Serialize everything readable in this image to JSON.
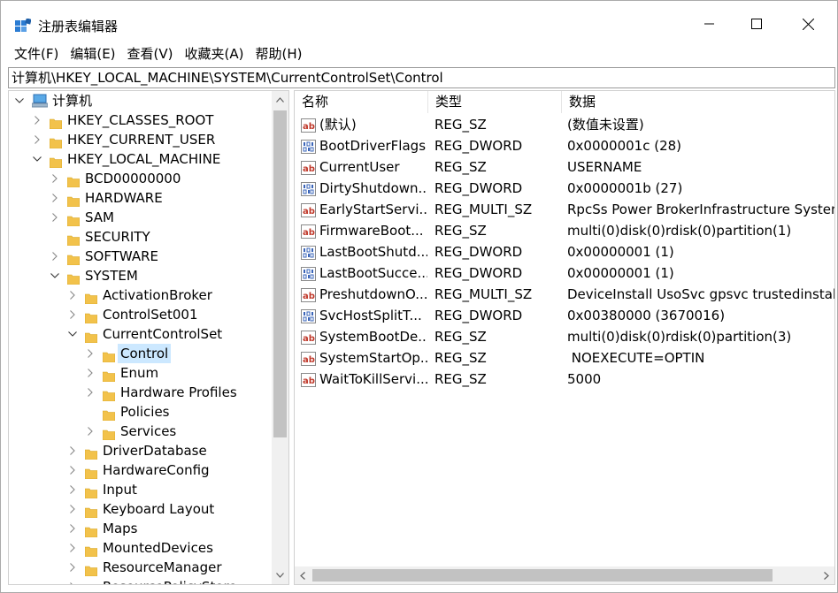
{
  "window": {
    "title": "注册表编辑器",
    "icon": "regedit-icon"
  },
  "menu": [
    "文件(F)",
    "编辑(E)",
    "查看(V)",
    "收藏夹(A)",
    "帮助(H)"
  ],
  "address": "计算机\\HKEY_LOCAL_MACHINE\\SYSTEM\\CurrentControlSet\\Control",
  "tree": [
    {
      "label": "计算机",
      "level": 0,
      "expander": "expanded",
      "icon": "computer-icon",
      "selected": false
    },
    {
      "label": "HKEY_CLASSES_ROOT",
      "level": 1,
      "expander": "collapsed",
      "icon": "folder-icon",
      "selected": false
    },
    {
      "label": "HKEY_CURRENT_USER",
      "level": 1,
      "expander": "collapsed",
      "icon": "folder-icon",
      "selected": false
    },
    {
      "label": "HKEY_LOCAL_MACHINE",
      "level": 1,
      "expander": "expanded",
      "icon": "folder-icon",
      "selected": false
    },
    {
      "label": "BCD00000000",
      "level": 2,
      "expander": "collapsed",
      "icon": "folder-icon",
      "selected": false
    },
    {
      "label": "HARDWARE",
      "level": 2,
      "expander": "collapsed",
      "icon": "folder-icon",
      "selected": false
    },
    {
      "label": "SAM",
      "level": 2,
      "expander": "collapsed",
      "icon": "folder-icon",
      "selected": false
    },
    {
      "label": "SECURITY",
      "level": 2,
      "expander": "none",
      "icon": "folder-icon",
      "selected": false
    },
    {
      "label": "SOFTWARE",
      "level": 2,
      "expander": "collapsed",
      "icon": "folder-icon",
      "selected": false
    },
    {
      "label": "SYSTEM",
      "level": 2,
      "expander": "expanded",
      "icon": "folder-icon",
      "selected": false
    },
    {
      "label": "ActivationBroker",
      "level": 3,
      "expander": "collapsed",
      "icon": "folder-icon",
      "selected": false
    },
    {
      "label": "ControlSet001",
      "level": 3,
      "expander": "collapsed",
      "icon": "folder-icon",
      "selected": false
    },
    {
      "label": "CurrentControlSet",
      "level": 3,
      "expander": "expanded",
      "icon": "folder-icon",
      "selected": false
    },
    {
      "label": "Control",
      "level": 4,
      "expander": "collapsed",
      "icon": "folder-open-icon",
      "selected": true
    },
    {
      "label": "Enum",
      "level": 4,
      "expander": "collapsed",
      "icon": "folder-icon",
      "selected": false
    },
    {
      "label": "Hardware Profiles",
      "level": 4,
      "expander": "collapsed",
      "icon": "folder-icon",
      "selected": false
    },
    {
      "label": "Policies",
      "level": 4,
      "expander": "none",
      "icon": "folder-icon",
      "selected": false
    },
    {
      "label": "Services",
      "level": 4,
      "expander": "collapsed",
      "icon": "folder-icon",
      "selected": false
    },
    {
      "label": "DriverDatabase",
      "level": 3,
      "expander": "collapsed",
      "icon": "folder-icon",
      "selected": false
    },
    {
      "label": "HardwareConfig",
      "level": 3,
      "expander": "collapsed",
      "icon": "folder-icon",
      "selected": false
    },
    {
      "label": "Input",
      "level": 3,
      "expander": "collapsed",
      "icon": "folder-icon",
      "selected": false
    },
    {
      "label": "Keyboard Layout",
      "level": 3,
      "expander": "collapsed",
      "icon": "folder-icon",
      "selected": false
    },
    {
      "label": "Maps",
      "level": 3,
      "expander": "collapsed",
      "icon": "folder-icon",
      "selected": false
    },
    {
      "label": "MountedDevices",
      "level": 3,
      "expander": "collapsed",
      "icon": "folder-icon",
      "selected": false
    },
    {
      "label": "ResourceManager",
      "level": 3,
      "expander": "collapsed",
      "icon": "folder-icon",
      "selected": false
    },
    {
      "label": "ResourcePolicyStore",
      "level": 3,
      "expander": "collapsed",
      "icon": "folder-icon",
      "selected": false
    }
  ],
  "columns": {
    "name": "名称",
    "type": "类型",
    "data": "数据"
  },
  "values": [
    {
      "name": "(默认)",
      "type": "REG_SZ",
      "data": "(数值未设置)",
      "icon": "string-value-icon"
    },
    {
      "name": "BootDriverFlags",
      "type": "REG_DWORD",
      "data": "0x0000001c (28)",
      "icon": "binary-value-icon"
    },
    {
      "name": "CurrentUser",
      "type": "REG_SZ",
      "data": "USERNAME",
      "icon": "string-value-icon"
    },
    {
      "name": "DirtyShutdown...",
      "type": "REG_DWORD",
      "data": "0x0000001b (27)",
      "icon": "binary-value-icon"
    },
    {
      "name": "EarlyStartServi...",
      "type": "REG_MULTI_SZ",
      "data": "RpcSs Power BrokerInfrastructure System",
      "icon": "string-value-icon"
    },
    {
      "name": "FirmwareBoot...",
      "type": "REG_SZ",
      "data": "multi(0)disk(0)rdisk(0)partition(1)",
      "icon": "string-value-icon"
    },
    {
      "name": "LastBootShutd...",
      "type": "REG_DWORD",
      "data": "0x00000001 (1)",
      "icon": "binary-value-icon"
    },
    {
      "name": "LastBootSucce...",
      "type": "REG_DWORD",
      "data": "0x00000001 (1)",
      "icon": "binary-value-icon"
    },
    {
      "name": "PreshutdownO...",
      "type": "REG_MULTI_SZ",
      "data": "DeviceInstall UsoSvc gpsvc trustedinstalle",
      "icon": "string-value-icon"
    },
    {
      "name": "SvcHostSplitT...",
      "type": "REG_DWORD",
      "data": "0x00380000 (3670016)",
      "icon": "binary-value-icon"
    },
    {
      "name": "SystemBootDe...",
      "type": "REG_SZ",
      "data": "multi(0)disk(0)rdisk(0)partition(3)",
      "icon": "string-value-icon"
    },
    {
      "name": "SystemStartOp...",
      "type": "REG_SZ",
      "data": " NOEXECUTE=OPTIN",
      "icon": "string-value-icon"
    },
    {
      "name": "WaitToKillServi...",
      "type": "REG_SZ",
      "data": "5000",
      "icon": "string-value-icon"
    }
  ],
  "colors": {
    "selection": "#cce8ff",
    "folder": "#f2c24b",
    "string_icon_text": "#c0392b",
    "binary_icon": "#3a64b8"
  }
}
